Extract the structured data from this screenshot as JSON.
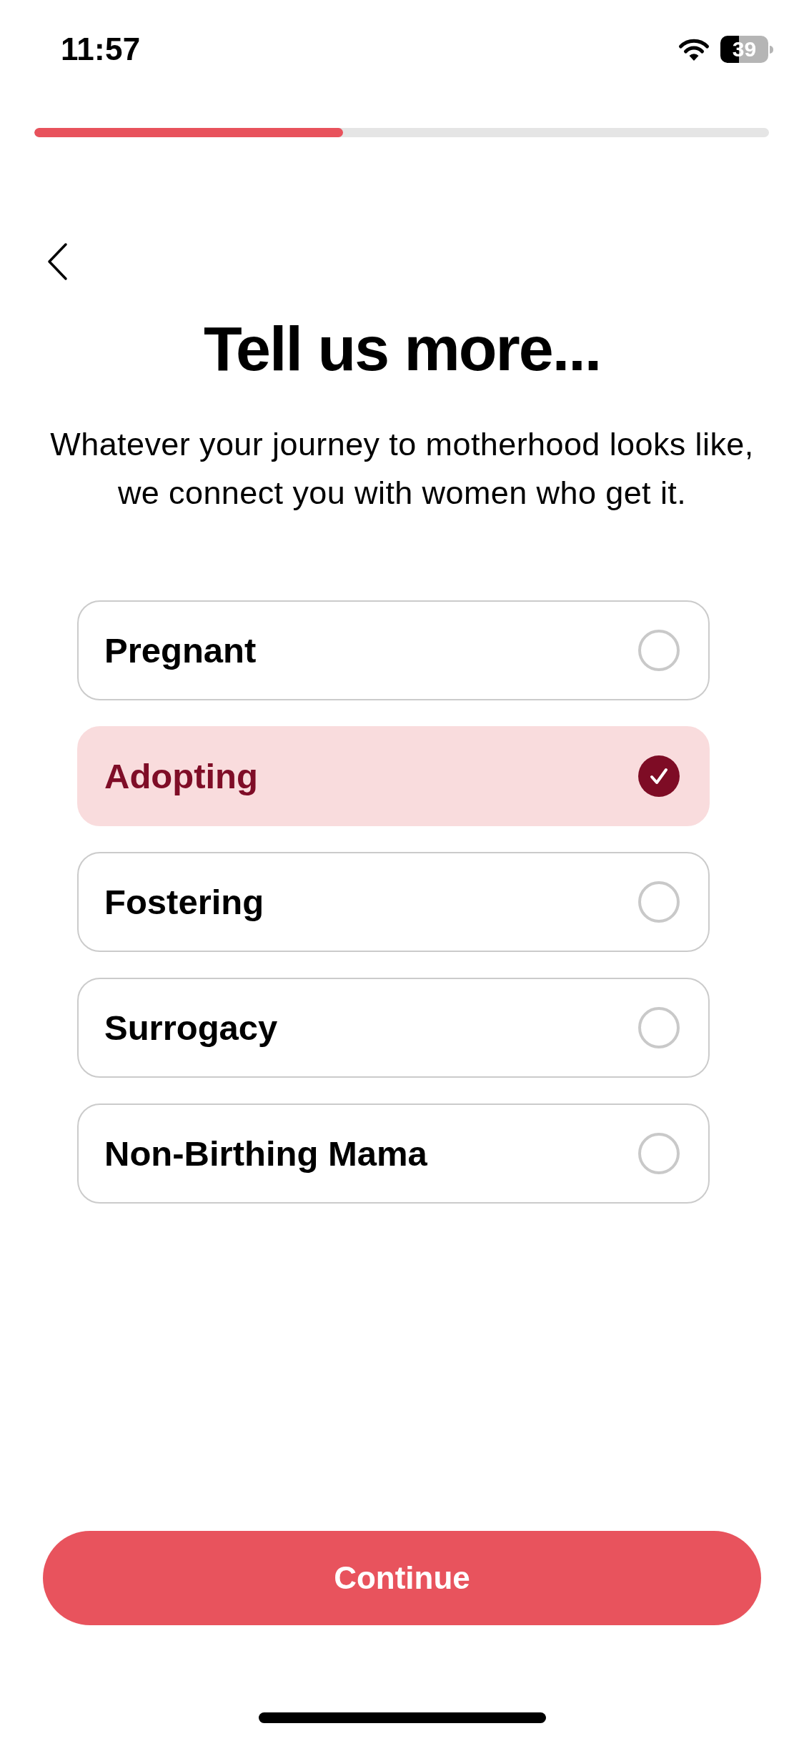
{
  "status_bar": {
    "time": "11:57",
    "battery": "39"
  },
  "progress": {
    "level": 0.42
  },
  "header": {
    "title": "Tell us more...",
    "subtitle": "Whatever your journey to motherhood looks like, we connect you with women who get it."
  },
  "options": [
    {
      "label": "Pregnant",
      "selected": false
    },
    {
      "label": "Adopting",
      "selected": true
    },
    {
      "label": "Fostering",
      "selected": false
    },
    {
      "label": "Surrogacy",
      "selected": false
    },
    {
      "label": "Non-Birthing Mama",
      "selected": false
    }
  ],
  "continue_button": {
    "label": "Continue"
  }
}
